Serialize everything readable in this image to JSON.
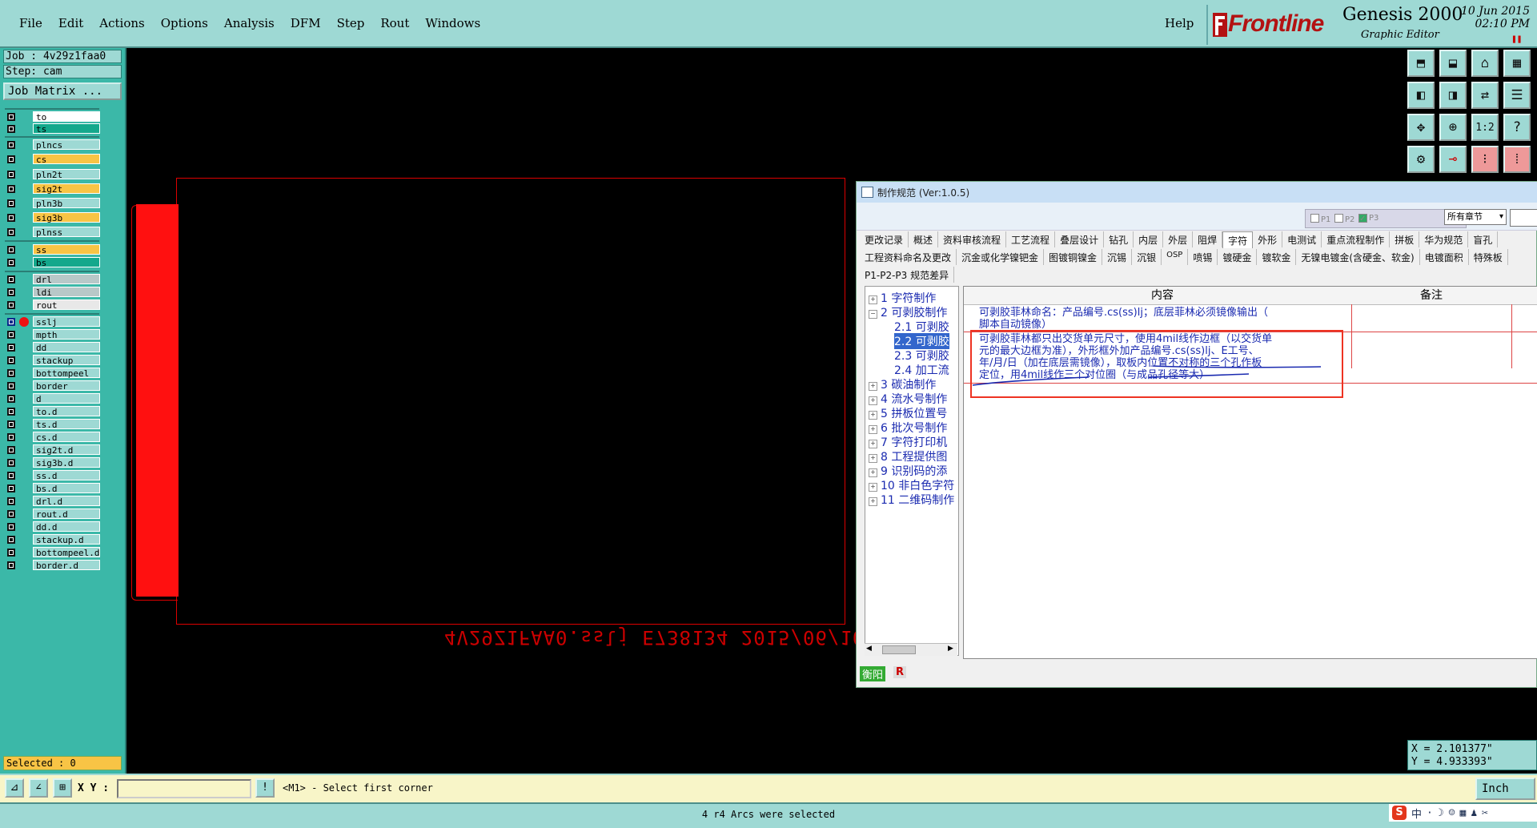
{
  "menubar": {
    "items": [
      "File",
      "Edit",
      "Actions",
      "Options",
      "Analysis",
      "DFM",
      "Step",
      "Rout",
      "Windows"
    ],
    "help": "Help"
  },
  "logo": {
    "brand": "Frontline",
    "product": "Genesis 2000",
    "subtitle": "Graphic Editor",
    "date": "10 Jun 2015",
    "time": "02:10 PM"
  },
  "left_panel": {
    "job": "Job : 4v29z1faa0",
    "step": "Step: cam",
    "job_matrix": "Job Matrix ...",
    "selected": "Selected : 0",
    "layers_group1": [
      {
        "name": "to",
        "color": "#ffffff"
      },
      {
        "name": "ts",
        "color": "#14a88c"
      },
      {
        "name": "plncs",
        "color": "#9ed9d4"
      },
      {
        "name": "cs",
        "color": "#f8c445"
      },
      {
        "name": "pln2t",
        "color": "#9ed9d4"
      },
      {
        "name": "sig2t",
        "color": "#f8c445"
      },
      {
        "name": "pln3b",
        "color": "#9ed9d4"
      },
      {
        "name": "sig3b",
        "color": "#f8c445"
      },
      {
        "name": "plnss",
        "color": "#9ed9d4"
      },
      {
        "name": "ss",
        "color": "#f8c445"
      },
      {
        "name": "bs",
        "color": "#14a88c"
      },
      {
        "name": "drl",
        "color": "#b8c8c8"
      },
      {
        "name": "ldi",
        "color": "#b8c8c8"
      },
      {
        "name": "rout",
        "color": "#e8e8e8"
      }
    ],
    "layers_group2": [
      "sslj",
      "mpth",
      "dd",
      "stackup",
      "bottompeel",
      "border",
      "d",
      "to.d",
      "ts.d",
      "cs.d",
      "sig2t.d",
      "sig3b.d",
      "ss.d",
      "bs.d",
      "drl.d",
      "rout.d",
      "dd.d",
      "stackup.d",
      "bottompeel.d",
      "border.d"
    ]
  },
  "canvas": {
    "mirror_text": "4V29Z1FAA0.sslj E738134 2015/06/10"
  },
  "toolbar": {
    "buttons": [
      "zoom-home-icon",
      "zoom-step-icon",
      "house-icon",
      "grid-icon",
      "pan-left-icon",
      "pan-right-icon",
      "swap-icon",
      "snap-icon",
      "fit-icon",
      "zoom-fit-icon",
      "ratio-label",
      "help-icon",
      "tools-icon",
      "brush-icon",
      "layer-red-icon",
      "layer-red2-icon"
    ],
    "ratio_label": "1:2"
  },
  "dialog": {
    "title": "制作规范 (Ver:1.0.5)",
    "phases": [
      "P1",
      "P2",
      "P3"
    ],
    "chapter_select": "所有章节",
    "tabs_row1": [
      "更改记录",
      "概述",
      "资料审核流程",
      "工艺流程",
      "叠层设计",
      "钻孔",
      "内层",
      "外层",
      "阻焊",
      "字符",
      "外形",
      "电测试",
      "重点流程制作",
      "拼板",
      "华为规范",
      "盲孔"
    ],
    "tabs_row1_active": "字符",
    "tabs_row2": [
      "工程资料命名及更改",
      "沉金或化学镍钯金",
      "图镀铜镍金",
      "沉锡",
      "沉银",
      "OSP",
      "喷锡",
      "镀硬金",
      "镀软金",
      "无镍电镀金(含硬金、软金)",
      "电镀面积",
      "特殊板"
    ],
    "tabs_row3": [
      "P1-P2-P3 规范差异"
    ],
    "tree": [
      {
        "label": "1 字符制作",
        "pm": "+"
      },
      {
        "label": "2 可剥胶制作",
        "pm": "−"
      },
      {
        "label": "2.1 可剥胶",
        "sub": true
      },
      {
        "label": "2.2 可剥胶",
        "sub": true,
        "selected": true
      },
      {
        "label": "2.3 可剥胶",
        "sub": true
      },
      {
        "label": "2.4 加工流",
        "sub": true
      },
      {
        "label": "3 碳油制作",
        "pm": "+"
      },
      {
        "label": "4 流水号制作",
        "pm": "+"
      },
      {
        "label": "5 拼板位置号",
        "pm": "+"
      },
      {
        "label": "6 批次号制作",
        "pm": "+"
      },
      {
        "label": "7 字符打印机",
        "pm": "+"
      },
      {
        "label": "8 工程提供图",
        "pm": "+"
      },
      {
        "label": "9 识别码的添",
        "pm": "+"
      },
      {
        "label": "10 非白色字符",
        "pm": "+"
      },
      {
        "label": "11 二维码制作",
        "pm": "+"
      }
    ],
    "table_headers": [
      "内容",
      "备注"
    ],
    "rows": [
      [
        "可剥胶菲林命名：产品编号.cs(ss)lj；底层菲林必须镜像输出（",
        "脚本自动镜像）"
      ],
      [
        "可剥胶菲林都只出交货单元尺寸，使用4mil线作边框（以交货单",
        "元的最大边框为准），外形框外加产品编号.cs(ss)lj、E工号、",
        "年/月/日（加在底层需镜像），取板内位置不对称的三个孔作板",
        "定位，用4mil线作三个对位圈（与成品孔径等大）"
      ]
    ],
    "bottom_label": "衡阳",
    "bottom_r": "R"
  },
  "bottom": {
    "xy_label": "X Y :",
    "xy_value": "",
    "prompt": "<M1> - Select first corner",
    "units": "Inch",
    "coord_x": "X = 2.101377\"",
    "coord_y": "Y = 4.933393\"",
    "status": "4 r4 Arcs were selected",
    "ime": [
      "S",
      "中",
      "·",
      "☽",
      "☺",
      "▦",
      "♟",
      "✂"
    ]
  }
}
